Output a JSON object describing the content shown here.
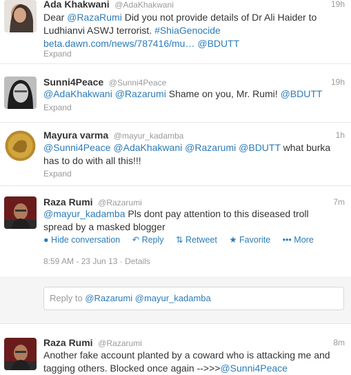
{
  "tweets": [
    {
      "name": "Ada Khakwani",
      "handle": "@AdaKhakwani",
      "time": "19h",
      "parts": [
        {
          "t": "Dear ",
          "c": "text"
        },
        {
          "t": "@RazaRumi",
          "c": "link"
        },
        {
          "t": " Did you not provide details of Dr Ali Haider to Ludhianvi ASWJ terrorist. ",
          "c": "text"
        },
        {
          "t": "#ShiaGenocide",
          "c": "link"
        },
        {
          "t": " ",
          "c": "text"
        },
        {
          "t": "beta.dawn.com/news/787416/mu…",
          "c": "link"
        },
        {
          "t": " ",
          "c": "text"
        },
        {
          "t": "@BDUTT",
          "c": "link"
        }
      ],
      "expand": "Expand"
    },
    {
      "name": "Sunni4Peace",
      "handle": "@Sunni4Peace",
      "time": "19h",
      "parts": [
        {
          "t": "@AdaKhakwani",
          "c": "link"
        },
        {
          "t": " ",
          "c": "text"
        },
        {
          "t": "@Razarumi",
          "c": "link"
        },
        {
          "t": " Shame on you, Mr. Rumi!  ",
          "c": "text"
        },
        {
          "t": "@BDUTT",
          "c": "link"
        }
      ],
      "expand": "Expand"
    },
    {
      "name": "Mayura varma",
      "handle": "@mayur_kadamba",
      "time": "1h",
      "parts": [
        {
          "t": "@Sunni4Peace",
          "c": "link"
        },
        {
          "t": " ",
          "c": "text"
        },
        {
          "t": "@AdaKhakwani",
          "c": "link"
        },
        {
          "t": " ",
          "c": "text"
        },
        {
          "t": "@Razarumi",
          "c": "link"
        },
        {
          "t": " ",
          "c": "text"
        },
        {
          "t": "@BDUTT",
          "c": "link"
        },
        {
          "t": " what burka has to do with all this!!!",
          "c": "text"
        }
      ],
      "expand": "Expand"
    },
    {
      "name": "Raza Rumi",
      "handle": "@Razarumi",
      "time": "7m",
      "parts": [
        {
          "t": "@mayur_kadamba",
          "c": "link"
        },
        {
          "t": " Pls dont pay attention to this diseased troll spread by a masked blogger",
          "c": "text"
        }
      ],
      "actions": [
        "Hide conversation",
        "Reply",
        "Retweet",
        "Favorite",
        "More"
      ],
      "meta": "8:59 AM - 23 Jun 13 · Details"
    },
    {
      "name": "Raza Rumi",
      "handle": "@Razarumi",
      "time": "8m",
      "parts": [
        {
          "t": "Another fake account planted by a coward who is attacking me and tagging others. Blocked once again -->>>",
          "c": "text"
        },
        {
          "t": "@Sunni4Peace",
          "c": "link"
        }
      ]
    }
  ],
  "reply": {
    "prefix": "Reply to ",
    "mentions": "@Razarumi @mayur_kadamba"
  },
  "colors": {
    "link": "#2b7bb9",
    "muted": "#999999",
    "text": "#333333"
  }
}
